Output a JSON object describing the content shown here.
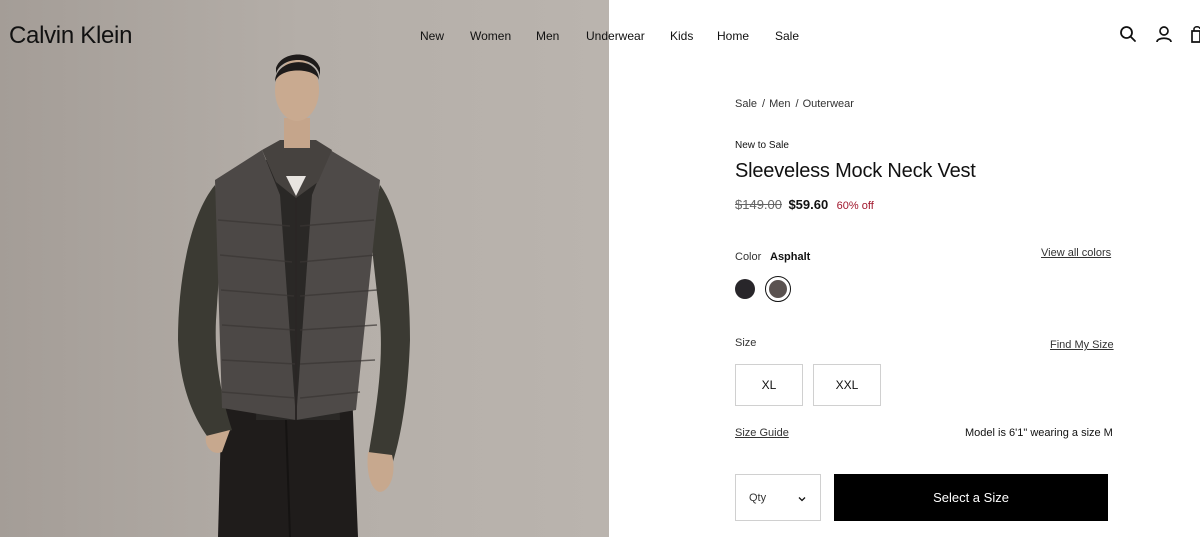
{
  "header": {
    "logo": "Calvin Klein",
    "nav": [
      "New",
      "Women",
      "Men",
      "Underwear",
      "Kids",
      "Home",
      "Sale"
    ],
    "icons": [
      "search-icon",
      "account-icon",
      "bag-icon"
    ]
  },
  "hero": {
    "image": "model-wearing-vest-photo"
  },
  "product": {
    "breadcrumb": [
      "Sale",
      "Men",
      "Outerwear"
    ],
    "breadcrumb_sep": "/",
    "badge": "New to Sale",
    "title": "Sleeveless Mock Neck Vest",
    "old_price": "$149.00",
    "price": "$59.60",
    "discount": "60% off",
    "discount_color": "#a1162c",
    "color_label": "Color",
    "color_value": "Asphalt",
    "view_all_colors": "View all colors",
    "swatches": [
      {
        "name": "black",
        "hex": "#28262a",
        "selected": false
      },
      {
        "name": "Asphalt",
        "hex": "#5a5250",
        "selected": true
      }
    ],
    "size_label": "Size",
    "find_my_size": "Find My Size",
    "sizes": [
      "XL",
      "XXL"
    ],
    "size_guide": "Size Guide",
    "model_info": "Model is 6'1\" wearing a size M",
    "qty_label": "Qty",
    "cta": "Select a Size"
  }
}
